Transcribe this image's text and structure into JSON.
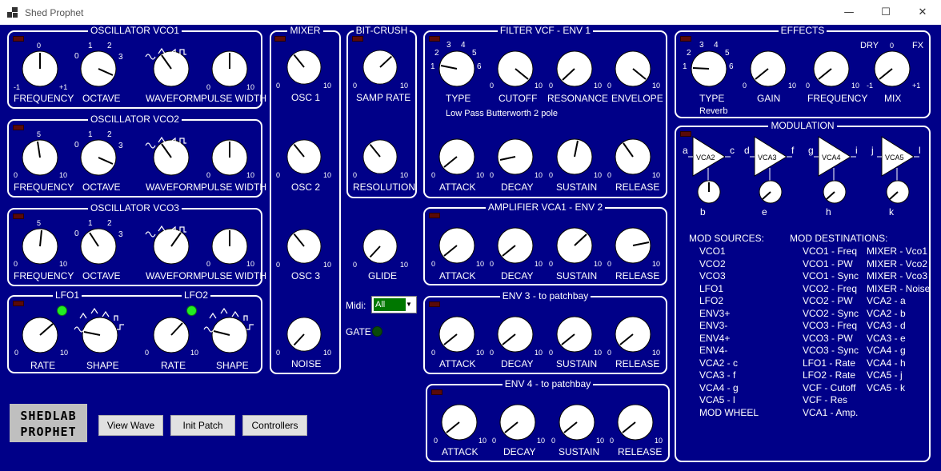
{
  "window": {
    "title": "Shed Prophet",
    "min": "—",
    "max": "☐",
    "close": "✕"
  },
  "panels": {
    "vco1": "OSCILLATOR VCO1",
    "vco2": "OSCILLATOR VCO2",
    "vco3": "OSCILLATOR VCO3",
    "lfo1": "LFO1",
    "lfo2": "LFO2",
    "mixer": "MIXER",
    "bitcrush": "BIT-CRUSH",
    "filter": "FILTER VCF - ENV 1",
    "amp": "AMPLIFIER VCA1 - ENV 2",
    "env3": "ENV 3 - to patchbay",
    "env4": "ENV 4 - to patchbay",
    "effects": "EFFECTS",
    "modulation": "MODULATION"
  },
  "labels": {
    "frequency": "FREQUENCY",
    "octave": "OCTAVE",
    "waveform": "WAVEFORM",
    "pulse_width": "PULSE WIDTH",
    "rate": "RATE",
    "shape": "SHAPE",
    "osc1": "OSC 1",
    "osc2": "OSC 2",
    "osc3": "OSC 3",
    "noise": "NOISE",
    "samp_rate": "SAMP RATE",
    "resolution": "RESOLUTION",
    "glide": "GLIDE",
    "type": "TYPE",
    "cutoff": "CUTOFF",
    "resonance": "RESONANCE",
    "envelope": "ENVELOPE",
    "attack": "ATTACK",
    "decay": "DECAY",
    "sustain": "SUSTAIN",
    "release": "RELEASE",
    "gain": "GAIN",
    "mix": "MIX",
    "dry": "DRY",
    "fx": "FX"
  },
  "ticks": {
    "zero": "0",
    "ten": "10",
    "one": "1",
    "two": "2",
    "three": "3",
    "four": "4",
    "five": "5",
    "six": "6",
    "m1": "-1",
    "p1": "+1",
    "pulse": "⅂"
  },
  "filter_type_value": "Low Pass Butterworth 2 pole",
  "effects_type_value": "Reverb",
  "midi": {
    "label": "Midi:",
    "value": "All"
  },
  "gate_label": "GATE",
  "buttons": {
    "view_wave": "View Wave",
    "init_patch": "Init Patch",
    "controllers": "Controllers"
  },
  "logo": {
    "line1": "SHEDLAB",
    "line2": "PROPHET"
  },
  "vcas": [
    {
      "label": "VCA2",
      "in": "a",
      "out": "c",
      "ctrl": "b"
    },
    {
      "label": "VCA3",
      "in": "d",
      "out": "f",
      "ctrl": "e"
    },
    {
      "label": "VCA4",
      "in": "g",
      "out": "i",
      "ctrl": "h"
    },
    {
      "label": "VCA5",
      "in": "j",
      "out": "l",
      "ctrl": "k"
    }
  ],
  "mod_sources": {
    "title": "MOD SOURCES:",
    "items": [
      "VCO1",
      "VCO2",
      "VCO3",
      "LFO1",
      "LFO2",
      "ENV3+",
      "ENV3-",
      "ENV4+",
      "ENV4-",
      "VCA2 - c",
      "VCA3 - f",
      "VCA4 - g",
      "VCA5 - l",
      "MOD WHEEL"
    ]
  },
  "mod_destinations": {
    "title": "MOD DESTINATIONS:",
    "col1": [
      "VCO1 - Freq",
      "VCO1 - PW",
      "VCO1 - Sync",
      "VCO2 - Freq",
      "VCO2 - PW",
      "VCO2 - Sync",
      "VCO3 - Freq",
      "VCO3 - PW",
      "VCO3 - Sync",
      "LFO1 - Rate",
      "LFO2 - Rate",
      "VCF - Cutoff",
      "VCF - Res",
      "VCA1 - Amp."
    ],
    "col2": [
      "MIXER - Vco1",
      "MIXER - Vco2",
      "MIXER - Vco3",
      "MIXER - Noise",
      "VCA2 - a",
      "VCA2 - b",
      "VCA3 - d",
      "VCA3 - e",
      "VCA4 - g",
      "VCA4 - h",
      "VCA5 - j",
      "VCA5 - k"
    ]
  },
  "colors": {
    "background": "#000088",
    "panel_border": "#ffffff",
    "led_on": "#22ee22",
    "led_off": "#5a0a08",
    "midi_select": "#007700"
  }
}
